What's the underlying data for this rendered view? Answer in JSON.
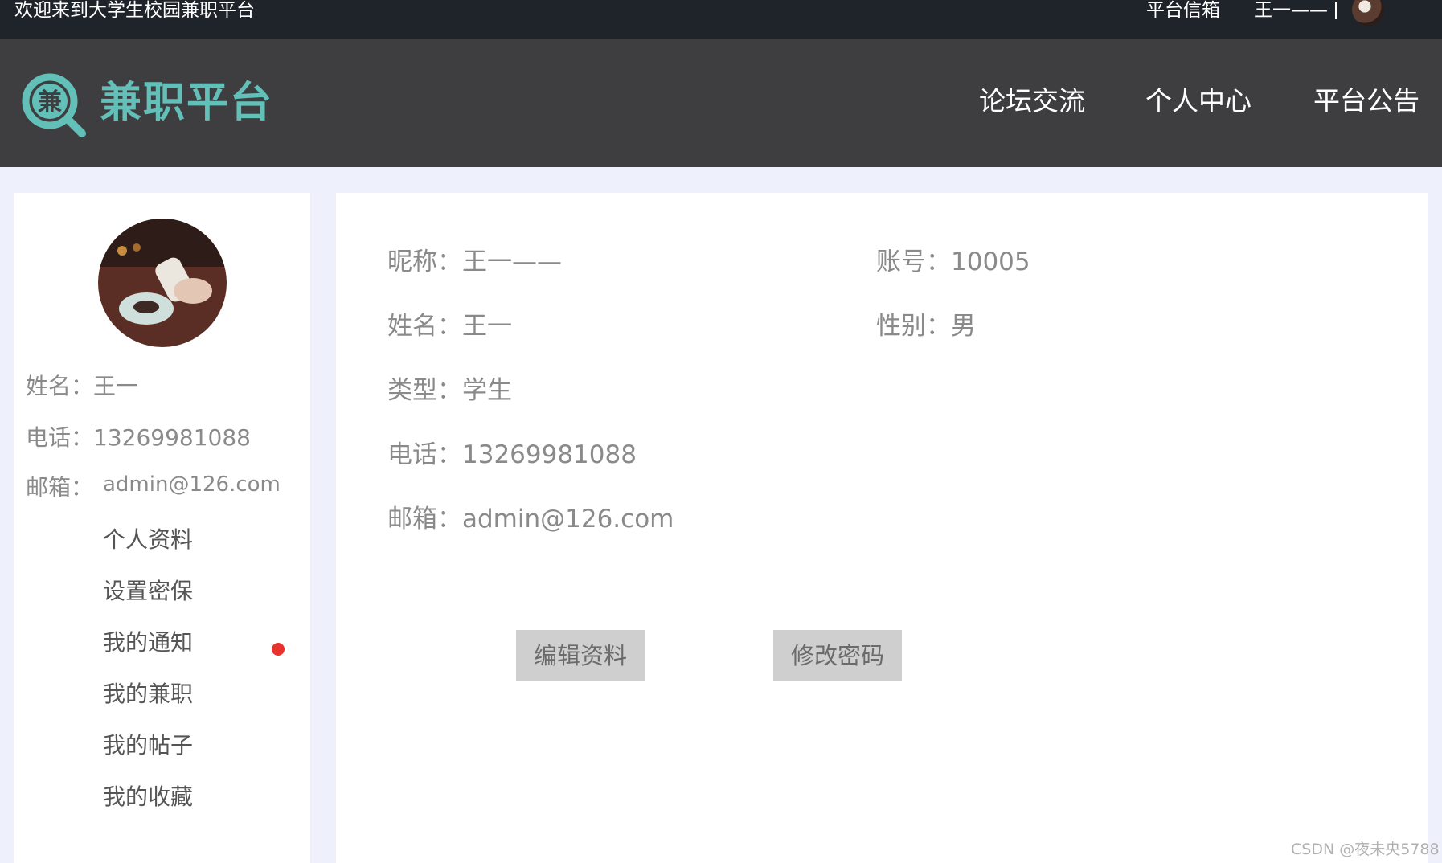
{
  "topbar": {
    "welcome": "欢迎来到大学生校园兼职平台",
    "mailbox": "平台信箱",
    "username": "王一——"
  },
  "header": {
    "logo_glyph": "兼",
    "logo_text": "兼职平台",
    "nav": [
      "论坛交流",
      "个人中心",
      "平台公告"
    ]
  },
  "sidebar": {
    "info": [
      {
        "label": "姓名：",
        "value": "王一"
      },
      {
        "label": "电话：",
        "value": "13269981088"
      },
      {
        "label": "邮箱：",
        "value": "admin@126.com"
      }
    ],
    "menu": [
      "个人资料",
      "设置密保",
      "我的通知",
      "我的兼职",
      "我的帖子",
      "我的收藏"
    ],
    "notification_dot_color": "#e8322c"
  },
  "profile": {
    "nickname_label": "昵称：",
    "nickname": "王一——",
    "account_label": "账号：",
    "account": "10005",
    "name_label": "姓名：",
    "name": "王一",
    "gender_label": "性别：",
    "gender": "男",
    "type_label": "类型：",
    "type": "学生",
    "phone_label": "电话：",
    "phone": "13269981088",
    "email_label": "邮箱：",
    "email": "admin@126.com"
  },
  "buttons": {
    "edit": "编辑资料",
    "change_password": "修改密码"
  },
  "watermark": "CSDN @夜未央5788",
  "colors": {
    "topbar_bg": "#1f232a",
    "header_bg": "#3e3e41",
    "brand": "#62c0b8",
    "page_bg": "#eef0fb"
  }
}
